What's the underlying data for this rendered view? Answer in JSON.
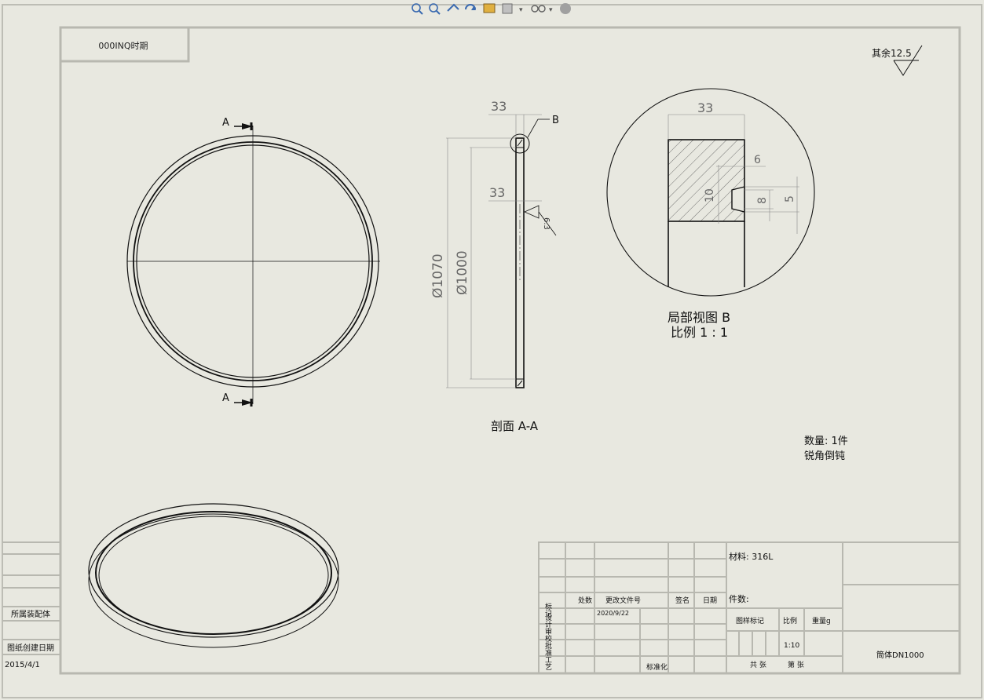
{
  "toolbar": {
    "icons": [
      "zoom-to-fit-icon",
      "zoom-area-icon",
      "previous-view-icon",
      "rotate-icon",
      "pan-icon",
      "view-orientation-icon",
      "display-style-icon",
      "hide-show-icon"
    ]
  },
  "sheet": {
    "mirrored_title": "000INQ时期",
    "surface_roughness": "其余12.5"
  },
  "views": {
    "section_marker": "A",
    "detail_marker": "B",
    "section_caption": "剖面 A-A",
    "detail_caption_1": "局部视图 B",
    "detail_caption_2": "比例 1 : 1",
    "section_dims": {
      "width_top": "33",
      "width_mid": "33",
      "outer_dia": "Ø1070",
      "inner_dia": "Ø1000",
      "roughness": "6.3"
    },
    "detail_dims": {
      "width": "33",
      "groove_depth": "6",
      "groove_outer": "10",
      "groove_mid": "8",
      "groove_inner": "5"
    }
  },
  "notes": {
    "quantity": "数量: 1件",
    "chamfer": "锐角倒钝"
  },
  "left_strip": {
    "assembly_label": "所属装配体",
    "date_label": "图纸创建日期",
    "date_value": "2015/4/1"
  },
  "title_block": {
    "col_mark": "标记",
    "col_count": "处数",
    "col_doc": "更改文件号",
    "col_sign": "签名",
    "col_date": "日期",
    "date_value": "2020/9/22",
    "row_labels": "设计审校批准工艺",
    "std_label": "标准化",
    "material": "材料: 316L",
    "part_count": "件数:",
    "sheet_mark": "图样标记",
    "scale_label": "比例",
    "weight_label": "重量g",
    "scale_value": "1:10",
    "sheets_total": "共  张",
    "sheet_no": "第  张",
    "part_name": "筒体DN1000"
  }
}
